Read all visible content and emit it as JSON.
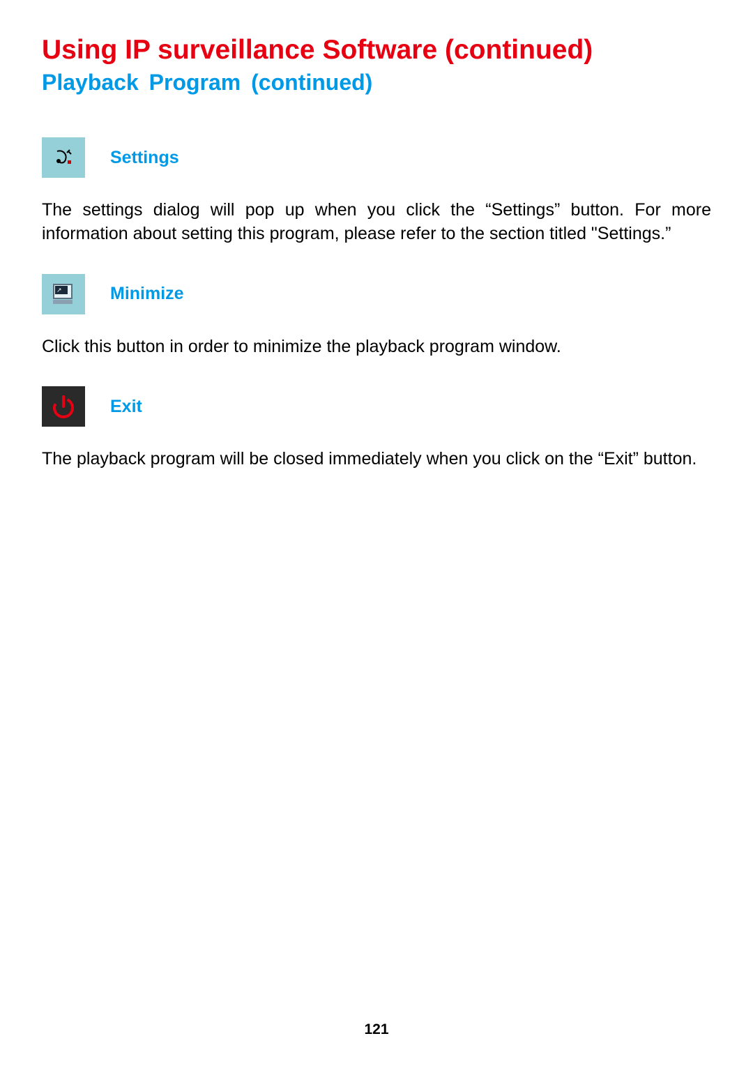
{
  "title": "Using IP surveillance Software (continued)",
  "subtitle": "Playback  Program  (continued)",
  "sections": {
    "settings": {
      "label": "Settings",
      "body": "The settings dialog will pop up when you click the “Settings” button. For more information about setting this program, please refer to the section titled \"Settings.”"
    },
    "minimize": {
      "label": "Minimize",
      "body": "Click this button in order to minimize the playback program window."
    },
    "exit": {
      "label": "Exit",
      "body": "The playback program will be closed immediately when you click on the “Exit” button."
    }
  },
  "page_number": "121"
}
